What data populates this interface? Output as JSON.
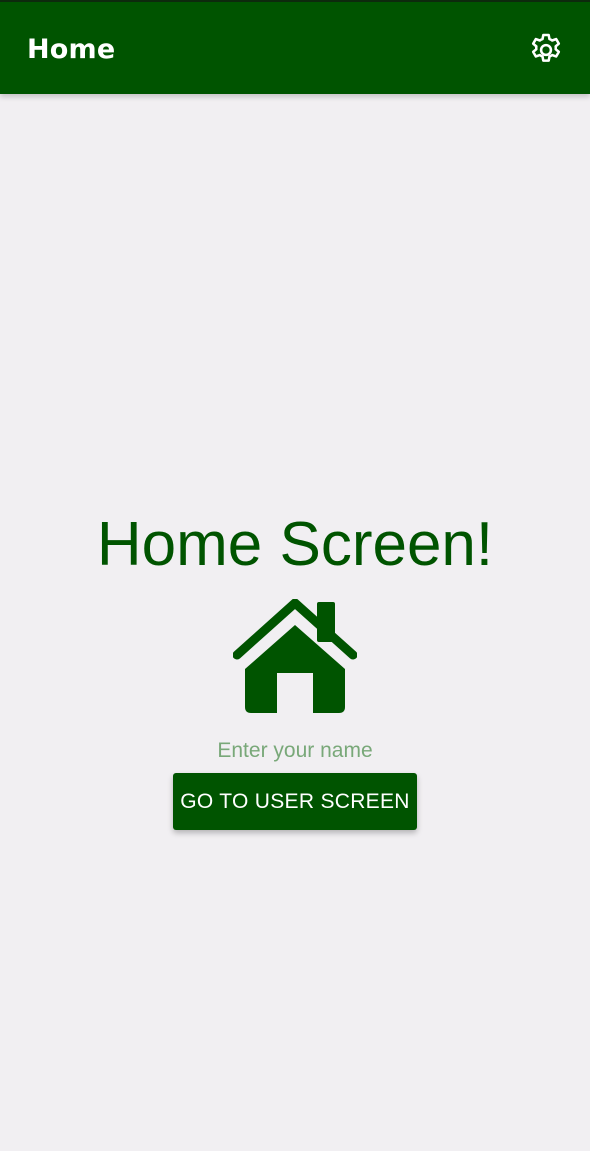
{
  "app_bar": {
    "title": "Home",
    "settings_icon": "gear-icon"
  },
  "main": {
    "heading": "Home Screen!",
    "hero_icon": "home-icon",
    "name_input": {
      "value": "",
      "placeholder": "Enter your name"
    },
    "go_button_label": "GO TO USER SCREEN"
  },
  "colors": {
    "primary": "#005400",
    "background": "#f1eff2",
    "on_primary": "#ffffff",
    "placeholder": "#79a879"
  }
}
